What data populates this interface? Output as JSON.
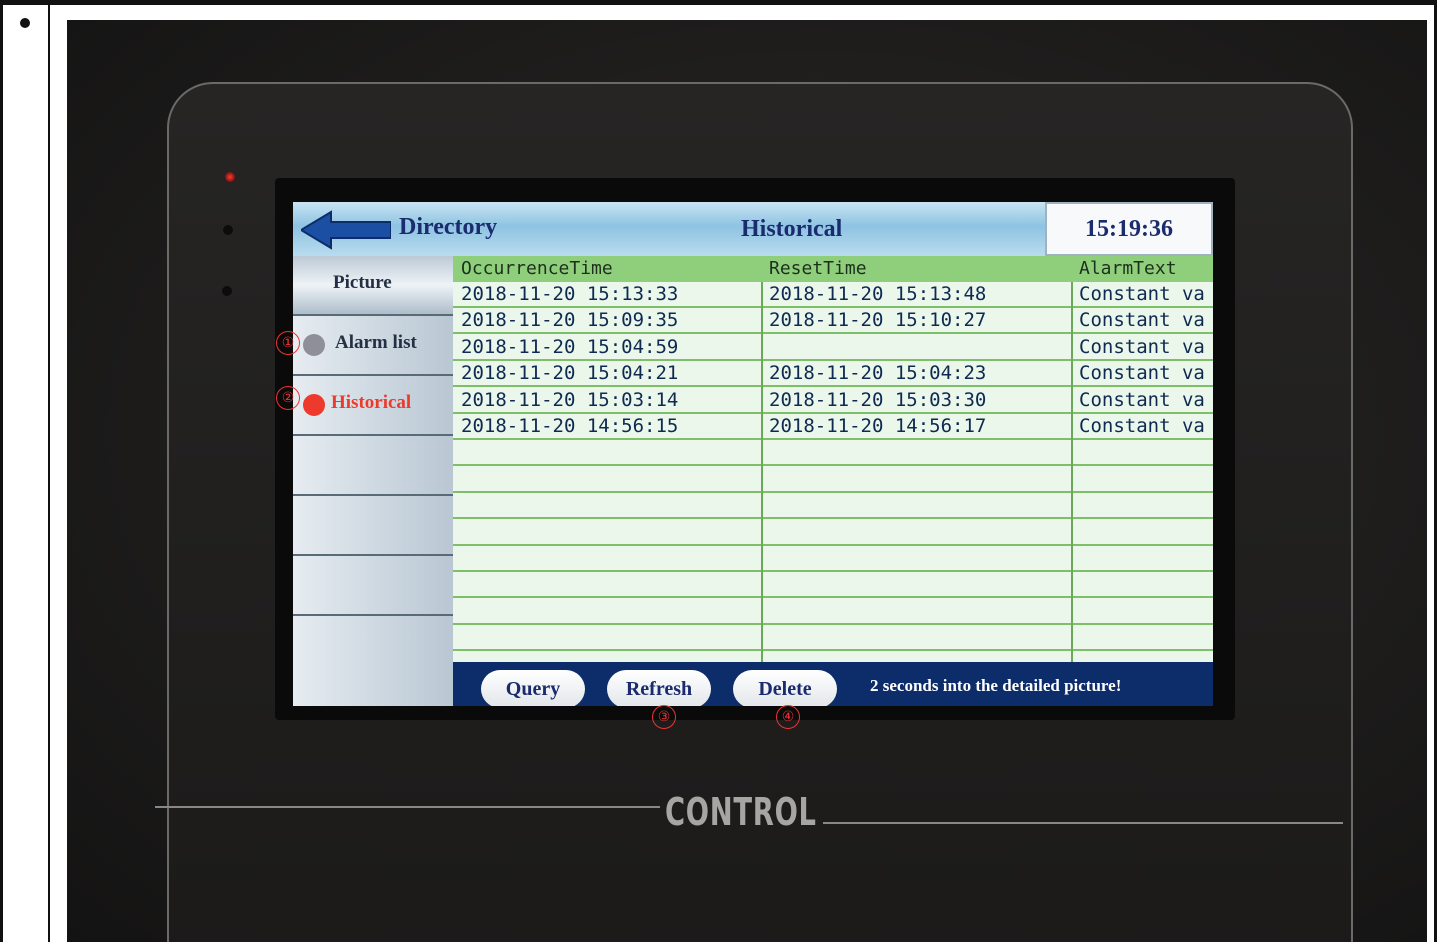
{
  "page": {
    "bullet": "•"
  },
  "hmi": {
    "header": {
      "directory_label": "Directory",
      "title": "Historical",
      "clock": "15:19:36",
      "back_icon": "back-arrow-icon"
    },
    "sidebar": {
      "items": [
        {
          "label": "Picture",
          "active": false
        },
        {
          "label": "Alarm list",
          "dot_color": "#8f8f99",
          "callout": "①"
        },
        {
          "label": "Historical",
          "dot_color": "#ee3a2d",
          "callout": "②",
          "active": true
        }
      ]
    },
    "table": {
      "columns": [
        "OccurrenceTime",
        "ResetTime",
        "AlarmText"
      ],
      "rows": [
        [
          "2018-11-20 15:13:33",
          "2018-11-20 15:13:48",
          "Constant va"
        ],
        [
          "2018-11-20 15:09:35",
          "2018-11-20 15:10:27",
          "Constant va"
        ],
        [
          "2018-11-20 15:04:59",
          "",
          "Constant va"
        ],
        [
          "2018-11-20 15:04:21",
          "2018-11-20 15:04:23",
          "Constant va"
        ],
        [
          "2018-11-20 15:03:14",
          "2018-11-20 15:03:30",
          "Constant va"
        ],
        [
          "2018-11-20 14:56:15",
          "2018-11-20 14:56:17",
          "Constant va"
        ]
      ],
      "empty_rows": 8
    },
    "toolbar": {
      "query_label": "Query",
      "refresh_label": "Refresh",
      "delete_label": "Delete",
      "message": "2 seconds into the detailed picture!",
      "refresh_callout": "③",
      "delete_callout": "④"
    }
  },
  "device": {
    "label": "CONTROL"
  },
  "colors": {
    "header_text": "#1a2b6e",
    "table_header": "#8fcf7c",
    "table_bg": "#eaf7ea",
    "toolbar_bg": "#0d2c6a",
    "active_item": "#ee3a2d"
  }
}
